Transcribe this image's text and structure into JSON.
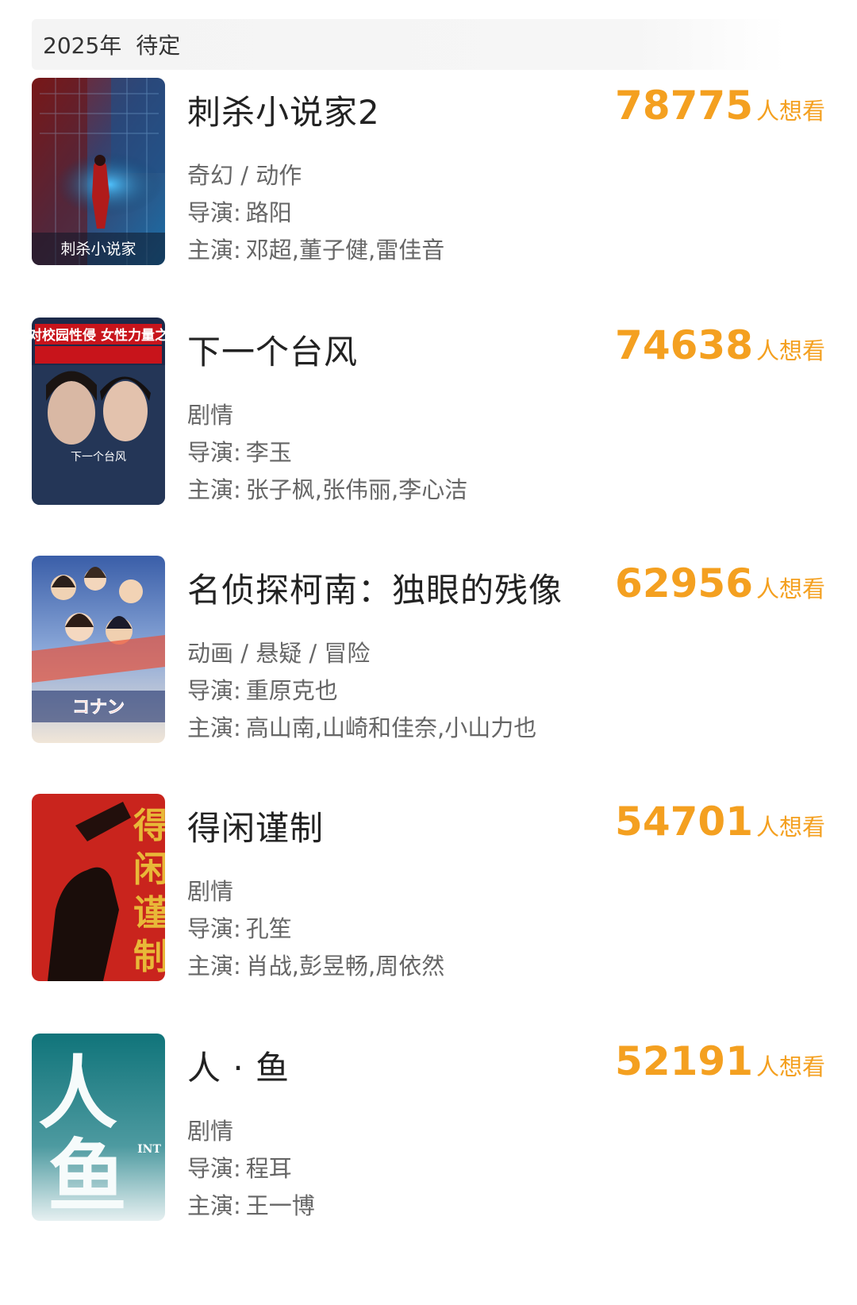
{
  "section": {
    "year": "2025年",
    "status": "待定"
  },
  "labels": {
    "director": "导演:",
    "cast": "主演:",
    "want_suffix": "人想看"
  },
  "movies": [
    {
      "title": "刺杀小说家2",
      "want_count": "78775",
      "genre": "奇幻 / 动作",
      "director": "路阳",
      "cast": "邓超,董子健,雷佳音",
      "poster_text": "刺杀小说家"
    },
    {
      "title": "下一个台风",
      "want_count": "74638",
      "genre": "剧情",
      "director": "李玉",
      "cast": "张子枫,张伟丽,李心洁",
      "poster_text": "反对校园性侵 女性力量之作"
    },
    {
      "title": "名侦探柯南：独眼的残像",
      "want_count": "62956",
      "genre": "动画 / 悬疑 / 冒险",
      "director": "重原克也",
      "cast": "高山南,山崎和佳奈,小山力也",
      "poster_text": "コナン"
    },
    {
      "title": "得闲谨制",
      "want_count": "54701",
      "genre": "剧情",
      "director": "孔笙",
      "cast": "肖战,彭昱畅,周依然",
      "poster_text": "得闲谨制"
    },
    {
      "title": "人 · 鱼",
      "want_count": "52191",
      "genre": "剧情",
      "director": "程耳",
      "cast": "王一博",
      "poster_text": "人鱼"
    }
  ]
}
